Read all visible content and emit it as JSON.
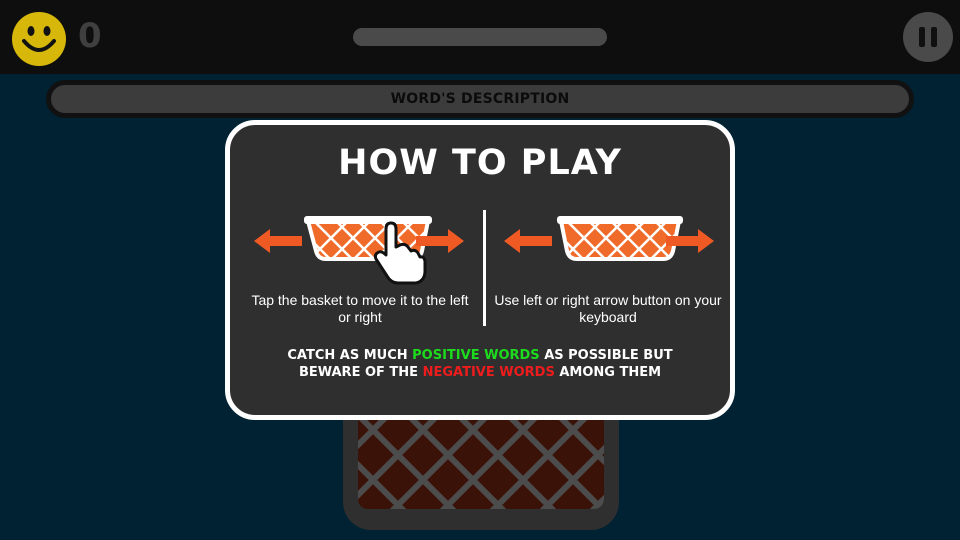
{
  "hud": {
    "score": "0",
    "smiley_icon": "smiley-face-icon",
    "pause_icon": "pause-icon"
  },
  "description_bar": {
    "label": "WORD'S DESCRIPTION"
  },
  "modal": {
    "title": "HOW TO PLAY",
    "left_caption": "Tap the basket to move it to the left or right",
    "right_caption": "Use left or right arrow button on your keyboard",
    "tip": {
      "part1": "CATCH AS MUCH ",
      "positive": "POSITIVE WORDS",
      "part2": " AS POSSIBLE BUT BEWARE OF THE ",
      "negative": "NEGATIVE WORDS",
      "part3": " AMONG THEM"
    }
  },
  "colors": {
    "positive": "#1ddc1d",
    "negative": "#ee1c1c",
    "arrow": "#ef5a24",
    "basket_fill": "#f06a2a",
    "smiley": "#d7b80a"
  }
}
